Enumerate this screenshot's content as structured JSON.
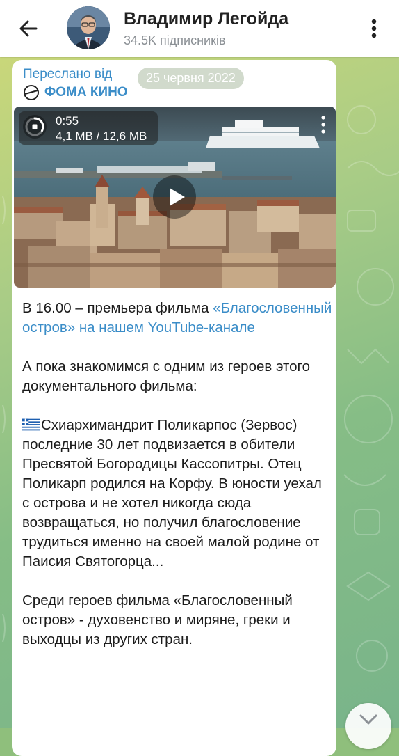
{
  "header": {
    "channel_name": "Владимир Легойда",
    "subscribers": "34.5K підписників",
    "back_icon": "arrow-left-icon",
    "menu_icon": "more-vertical-icon"
  },
  "message": {
    "forwarded_label": "Переслано від",
    "forwarded_source": "ФОМА КИНО",
    "date": "25 червня 2022",
    "video": {
      "duration": "0:55",
      "size": "4,1 MB / 12,6 MB",
      "download_progress": 0.33
    },
    "text": {
      "p1_prefix": "В 16.00 – премьера фильма ",
      "p1_link": "«Благословенный остров» на нашем YouTube-канале",
      "p2": "А пока знакомимся с одним из героев этого документального фильма:",
      "p3": "Схиархимандрит Поликарпос (Зервос) последние 30 лет подвизается в обители Пресвятой Богородицы Кассопитры. Отец Поликарп родился на Корфу. В юности уехал с острова и не хотел никогда сюда возвращаться, но получил благословение трудиться именно на своей малой родине от Паисия Святогорца...",
      "p4": "Среди героев фильма «Благословенный остров» - духовенство и миряне, греки и выходцы из других стран."
    }
  },
  "colors": {
    "accent": "#3b8dc8",
    "chat_background": "#9cc885"
  }
}
